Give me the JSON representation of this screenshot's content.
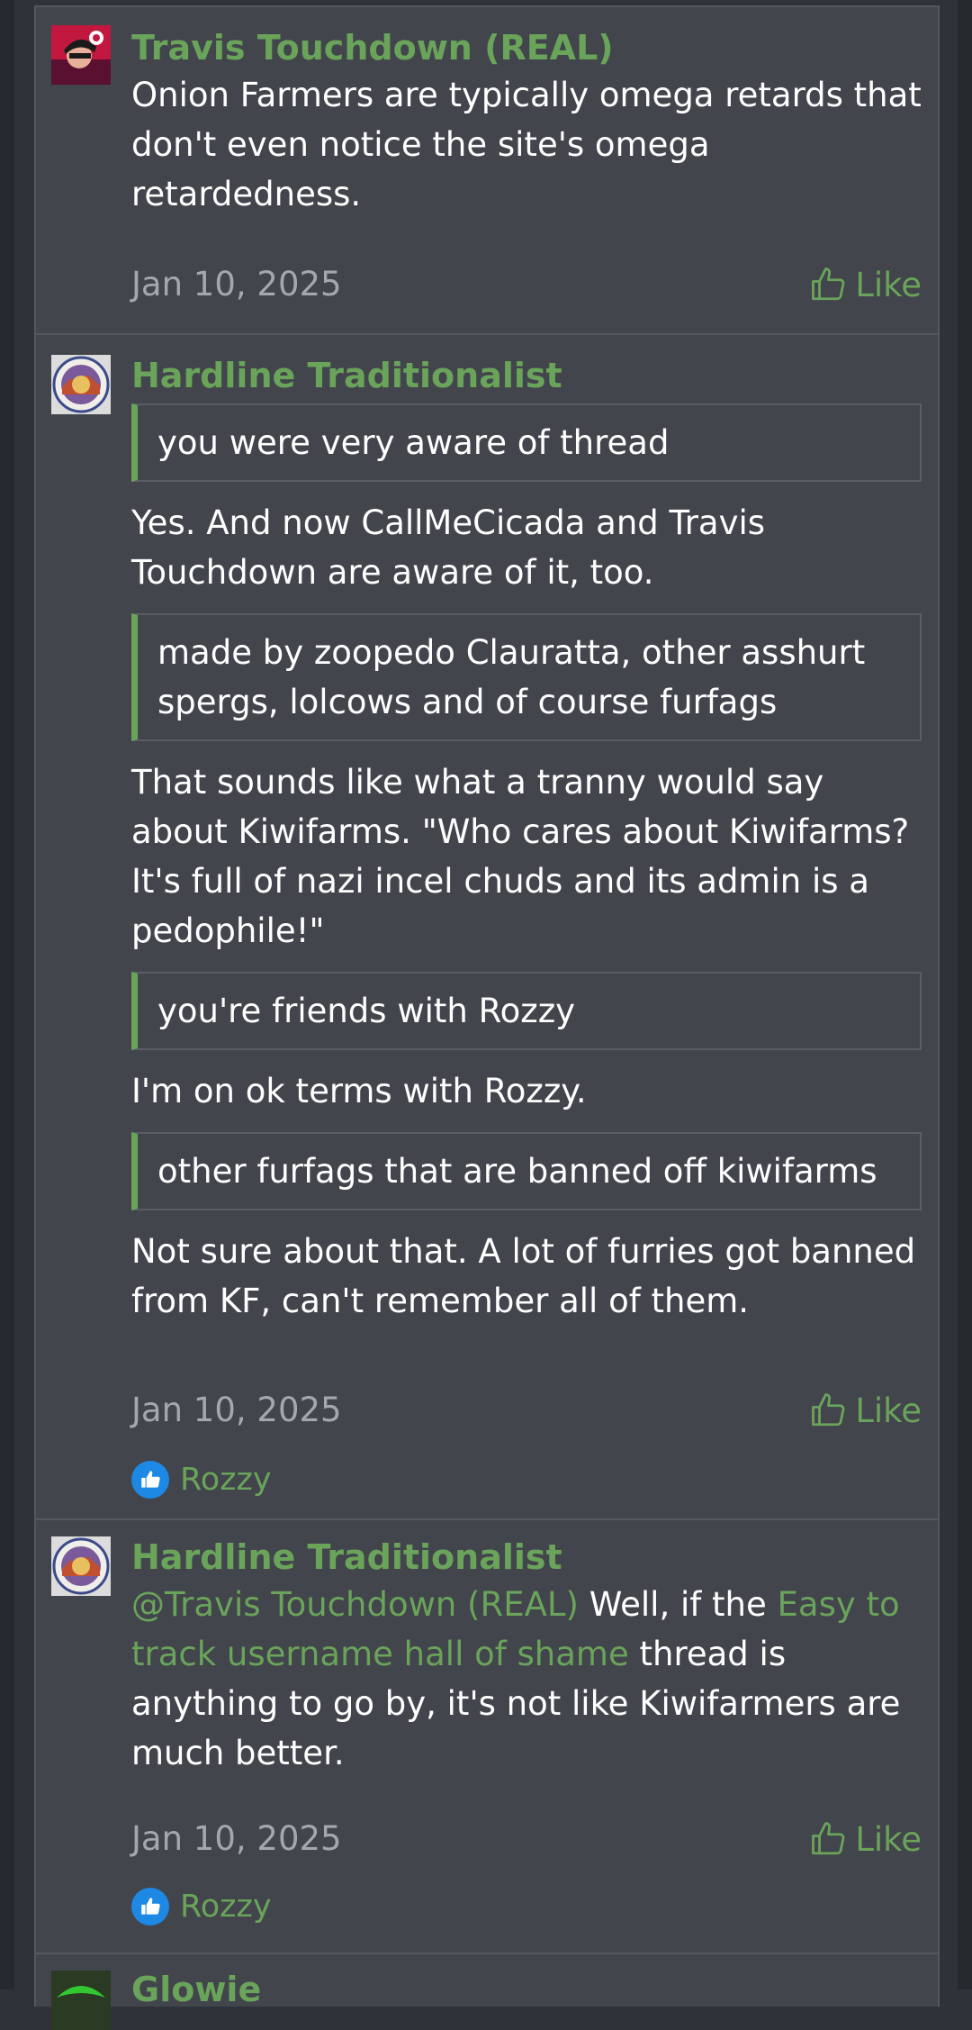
{
  "posts": [
    {
      "username": "Travis Touchdown (REAL)",
      "text": "Onion Farmers are typically omega retards that don't even notice the site's omega retardedness.",
      "date": "Jan 10, 2025",
      "like_label": "Like"
    },
    {
      "username": "Hardline Traditionalist",
      "blocks": [
        {
          "type": "quote",
          "text": "you were very aware of thread"
        },
        {
          "type": "text",
          "text": "Yes. And now CallMeCicada and Travis Touchdown are aware of it, too."
        },
        {
          "type": "quote",
          "text": "made by zoopedo Clauratta, other asshurt spergs, lolcows and of course furfags"
        },
        {
          "type": "text",
          "text": "That sounds like what a tranny would say about Kiwifarms. \"Who cares about Kiwifarms? It's full of nazi incel chuds and its admin is a pedophile!\""
        },
        {
          "type": "quote",
          "text": "you're friends with Rozzy"
        },
        {
          "type": "text",
          "text": "I'm on ok terms with Rozzy."
        },
        {
          "type": "quote",
          "text": "other furfags that are banned off kiwifarms"
        },
        {
          "type": "text",
          "text": "Not sure about that. A lot of furries got banned from KF, can't remember all of them."
        }
      ],
      "date": "Jan 10, 2025",
      "like_label": "Like",
      "reaction_user": "Rozzy"
    },
    {
      "username": "Hardline Traditionalist",
      "mention": "@Travis Touchdown (REAL)",
      "text_1": " Well, if the ",
      "link_text": "Easy to track username hall of shame",
      "text_2": " thread is anything to go by, it's not like Kiwifarmers are much better.",
      "date": "Jan 10, 2025",
      "like_label": "Like",
      "reaction_user": "Rozzy"
    },
    {
      "username": "Glowie"
    }
  ],
  "colors": {
    "username": "#6aa35a",
    "text": "#ffffff",
    "date": "#a4a8ad",
    "post_bg": "#42454c",
    "page_bg": "#2f3238",
    "reaction": "#1e88e5"
  }
}
